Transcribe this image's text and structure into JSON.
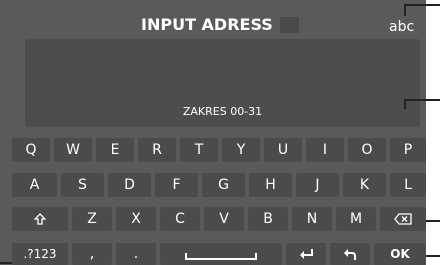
{
  "header": {
    "title": "INPUT ADRESS",
    "mode_label": "abc"
  },
  "input": {
    "range_label": "ZAKRES 00-31"
  },
  "keyboard": {
    "row1": [
      "Q",
      "W",
      "E",
      "R",
      "T",
      "Y",
      "U",
      "I",
      "O",
      "P"
    ],
    "row2": [
      "A",
      "S",
      "D",
      "F",
      "G",
      "H",
      "J",
      "K",
      "L"
    ],
    "row3": [
      "Z",
      "X",
      "C",
      "V",
      "B",
      "N",
      "M"
    ],
    "row4": {
      "symbols": ".?123",
      "comma": ",",
      "period": ".",
      "ok": "OK"
    }
  }
}
